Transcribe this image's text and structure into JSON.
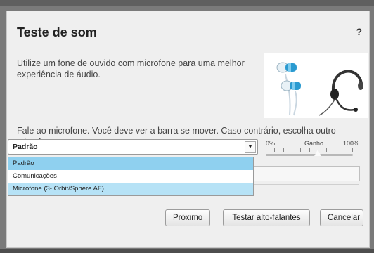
{
  "dialog": {
    "title": "Teste de som",
    "help_label": "?",
    "intro_text": "Utilize um fone de ouvido com microfone para uma melhor experiência de áudio.",
    "prompt_text": "Fale ao microfone. Você deve ver a barra se mover. Caso contrário, escolha outro microfone."
  },
  "microphone": {
    "selected_value": "Padrão",
    "options": [
      "Padrão",
      "Comunicações",
      "Microfone (3- Orbit/Sphere AF)"
    ]
  },
  "gain": {
    "min_label": "0%",
    "title_label": "Ganho",
    "max_label": "100%",
    "level_fraction": 0.6
  },
  "buttons": {
    "next_label": "Próximo",
    "test_speakers_label": "Testar alto-falantes",
    "cancel_label": "Cancelar"
  },
  "icons": {
    "help": "question-mark-icon",
    "dropdown": "chevron-down-icon",
    "illustration": "headset-earbuds-illustration"
  },
  "colors": {
    "accent": "#39a6d6",
    "selected_option": "#8fd0ef",
    "hover_option": "#b6e2f6"
  }
}
